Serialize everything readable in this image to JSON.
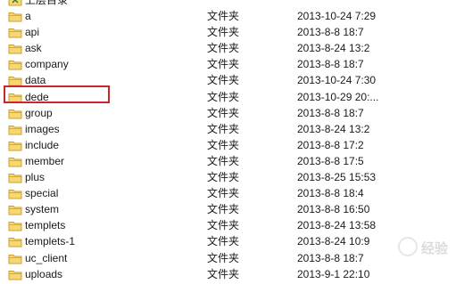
{
  "parent_folder": {
    "label": "上层目录"
  },
  "files": [
    {
      "name": "a",
      "type": "文件夹",
      "date": "2013-10-24 7:29"
    },
    {
      "name": "api",
      "type": "文件夹",
      "date": "2013-8-8 18:7"
    },
    {
      "name": "ask",
      "type": "文件夹",
      "date": "2013-8-24 13:2"
    },
    {
      "name": "company",
      "type": "文件夹",
      "date": "2013-8-8 18:7"
    },
    {
      "name": "data",
      "type": "文件夹",
      "date": "2013-10-24 7:30"
    },
    {
      "name": "dede",
      "type": "文件夹",
      "date": "2013-10-29 20:..."
    },
    {
      "name": "group",
      "type": "文件夹",
      "date": "2013-8-8 18:7"
    },
    {
      "name": "images",
      "type": "文件夹",
      "date": "2013-8-24 13:2"
    },
    {
      "name": "include",
      "type": "文件夹",
      "date": "2013-8-8 17:2"
    },
    {
      "name": "member",
      "type": "文件夹",
      "date": "2013-8-8 17:5"
    },
    {
      "name": "plus",
      "type": "文件夹",
      "date": "2013-8-25 15:53"
    },
    {
      "name": "special",
      "type": "文件夹",
      "date": "2013-8-8 18:4"
    },
    {
      "name": "system",
      "type": "文件夹",
      "date": "2013-8-8 16:50"
    },
    {
      "name": "templets",
      "type": "文件夹",
      "date": "2013-8-24 13:58"
    },
    {
      "name": "templets-1",
      "type": "文件夹",
      "date": "2013-8-24 10:9"
    },
    {
      "name": "uc_client",
      "type": "文件夹",
      "date": "2013-8-8 18:7"
    },
    {
      "name": "uploads",
      "type": "文件夹",
      "date": "2013-9-1 22:10"
    }
  ],
  "highlighted_item": "dede",
  "icons": {
    "folder": "folder-icon",
    "parent": "parent-folder-icon"
  },
  "colors": {
    "highlight": "#c8262c",
    "folder_fill": "#f7d774",
    "folder_edge": "#c9a22f"
  },
  "watermark": {
    "text": "经验"
  }
}
